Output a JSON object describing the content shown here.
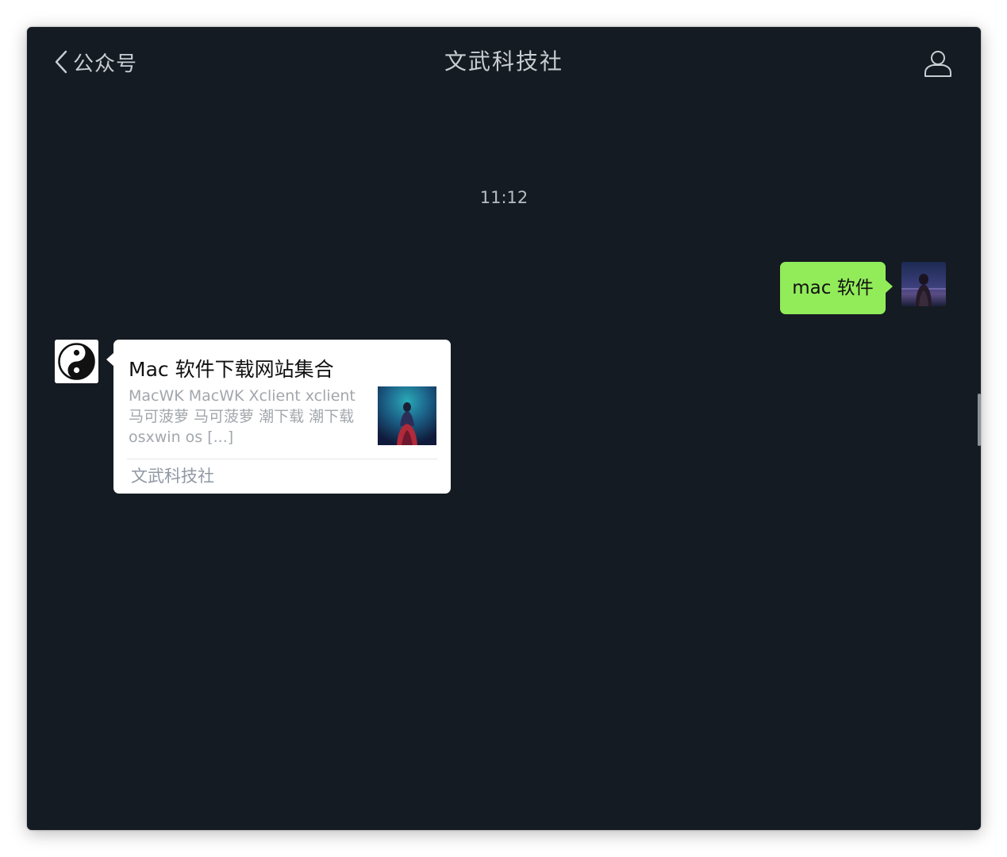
{
  "header": {
    "back_label": "公众号",
    "title": "文武科技社"
  },
  "chat": {
    "timestamp": "11:12",
    "sent_message": "mac 软件",
    "card": {
      "title": "Mac 软件下载网站集合",
      "description": "MacWK MacWK Xclient xclient 马可菠萝 马可菠萝 潮下载 潮下载 osxwin os [...]",
      "source": "文武科技社"
    }
  },
  "colors": {
    "background": "#151b22",
    "sent_bubble": "#92ec5a",
    "card_background": "#ffffff",
    "header_text": "#c8cdd2"
  },
  "icons": {
    "back": "chevron-left-icon",
    "profile": "person-outline-icon",
    "public_account_avatar": "yin-yang-icon"
  }
}
